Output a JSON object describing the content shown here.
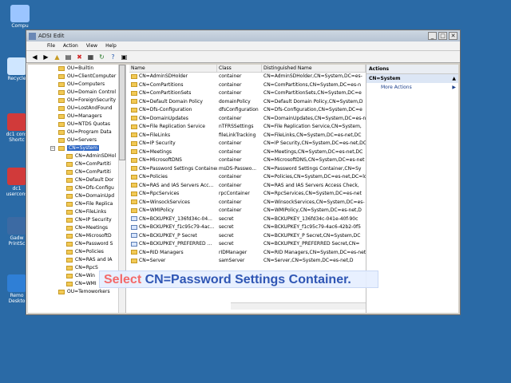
{
  "desktop": {
    "icons": [
      {
        "label": "Compu",
        "x": "",
        "y": "",
        "name": "computer"
      },
      {
        "label": "Recycle",
        "name": "recycle"
      },
      {
        "label": "dc1 cons Shortc",
        "name": "dc1-console"
      },
      {
        "label": "dc1 usercons",
        "name": "dc1-usercons"
      },
      {
        "label": "Gadw PrintSc",
        "name": "gadw"
      },
      {
        "label": "Remo Deskto",
        "name": "remote"
      }
    ]
  },
  "window": {
    "title": "ADSI Edit",
    "menu": [
      "File",
      "Action",
      "View",
      "Help"
    ],
    "toolbar": [
      "back-icon",
      "forward-icon",
      "folder-up-icon",
      "properties-icon",
      "delete-icon",
      "export-icon",
      "help-icon",
      "view-icon"
    ]
  },
  "tree": {
    "rows": [
      {
        "label": "OU=Builtin"
      },
      {
        "label": "OU=ClientComputer"
      },
      {
        "label": "OU=Computers"
      },
      {
        "label": "OU=Domain Control"
      },
      {
        "label": "OU=ForeignSecurity"
      },
      {
        "label": "OU=LostAndFound"
      },
      {
        "label": "OU=Managers"
      },
      {
        "label": "OU=NTDS Quotas"
      },
      {
        "label": "OU=Program Data"
      },
      {
        "label": "OU=Servers"
      },
      {
        "label": "CN=System",
        "selected": true
      },
      {
        "label": "CN=AdminSDHol"
      },
      {
        "label": "CN=ComPartiti"
      },
      {
        "label": "CN=ComPartiti"
      },
      {
        "label": "CN=Default Dor"
      },
      {
        "label": "CN=Dfs-Configu"
      },
      {
        "label": "CN=DomainUpd"
      },
      {
        "label": "CN=File Replica"
      },
      {
        "label": "CN=FileLinks"
      },
      {
        "label": "CN=IP Security"
      },
      {
        "label": "CN=Meetings"
      },
      {
        "label": "CN=MicrosoftD"
      },
      {
        "label": "CN=Password S"
      },
      {
        "label": "CN=Policies"
      },
      {
        "label": "CN=RAS and IA"
      },
      {
        "label": "CN=RpcS"
      },
      {
        "label": "CN=Win"
      },
      {
        "label": "CN=WMI"
      },
      {
        "label": "OU=Temoworkers"
      }
    ]
  },
  "list": {
    "headers": [
      "Name",
      "Class",
      "Distinguished Name"
    ],
    "rows": [
      [
        "CN=AdminSDHolder",
        "container",
        "CN=AdminSDHolder,CN=System,DC=es-"
      ],
      [
        "CN=ComPartitions",
        "container",
        "CN=ComPartitions,CN=System,DC=es-n"
      ],
      [
        "CN=ComPartitionSets",
        "container",
        "CN=ComPartitionSets,CN=System,DC=e"
      ],
      [
        "CN=Default Domain Policy",
        "domainPolicy",
        "CN=Default Domain Policy,CN=System,D"
      ],
      [
        "CN=Dfs-Configuration",
        "dfsConfiguration",
        "CN=Dfs-Configuration,CN=System,DC=e"
      ],
      [
        "CN=DomainUpdates",
        "container",
        "CN=DomainUpdates,CN=System,DC=es-ne"
      ],
      [
        "CN=File Replication Service",
        "nTFRSSettings",
        "CN=File Replication Service,CN=System,"
      ],
      [
        "CN=FileLinks",
        "fileLinkTracking",
        "CN=FileLinks,CN=System,DC=es-net,DC"
      ],
      [
        "CN=IP Security",
        "container",
        "CN=IP Security,CN=System,DC=es-net,DC"
      ],
      [
        "CN=Meetings",
        "container",
        "CN=Meetings,CN=System,DC=es-net,DC"
      ],
      [
        "CN=MicrosoftDNS",
        "container",
        "CN=MicrosoftDNS,CN=System,DC=es-net"
      ],
      [
        "CN=Password Settings Container",
        "msDS-Passwo...",
        "CN=Password Settings Container,CN=Sy"
      ],
      [
        "CN=Policies",
        "container",
        "CN=Policies,CN=System,DC=es-net,DC=lo"
      ],
      [
        "CN=RAS and IAS Servers Acc...",
        "container",
        "CN=RAS and IAS Servers Access Check,"
      ],
      [
        "CN=RpcServices",
        "rpcContainer",
        "CN=RpcServices,CN=System,DC=es-net"
      ],
      [
        "CN=WinsockServices",
        "container",
        "CN=WinsockServices,CN=System,DC=es-"
      ],
      [
        "CN=WMIPolicy",
        "container",
        "CN=WMIPolicy,CN=System,DC=es-net,D"
      ],
      [
        "CN=BCKUPKEY_136fd34c-04...",
        "secret",
        "CN=BCKUPKEY_136fd34c-041e-40f-90c"
      ],
      [
        "CN=BCKUPKEY_f1c95c79-4ac...",
        "secret",
        "CN=BCKUPKEY_f1c95c79-4ac6-42b2-0f5"
      ],
      [
        "CN=BCKUPKEY_P Secret",
        "secret",
        "CN=BCKUPKEY_P Secret,CN=System,DC"
      ],
      [
        "CN=BCKUPKEY_PREFERRED ...",
        "secret",
        "CN=BCKUPKEY_PREFERRED Secret,CN="
      ],
      [
        "CN=RID Managers",
        "rIDManager",
        "CN=RID Managers,CN=System,DC=es-net"
      ],
      [
        "CN=Server",
        "samServer",
        "CN=Server,CN=System,DC=es-net,D"
      ]
    ]
  },
  "actions": {
    "header": "Actions",
    "section": "CN=System",
    "more": "More Actions"
  },
  "callout": {
    "prefix": "Select",
    "text": "CN=Password Settings Container."
  }
}
